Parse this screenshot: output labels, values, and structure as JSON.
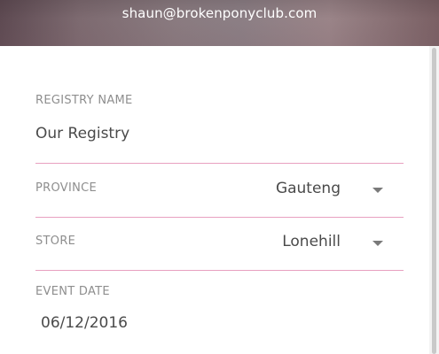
{
  "header": {
    "email": "shaun@brokenponyclub.com"
  },
  "form": {
    "registry_name": {
      "label": "REGISTRY NAME",
      "value": "Our Registry"
    },
    "province": {
      "label": "PROVINCE",
      "value": "Gauteng",
      "icon": "chevron-down-icon"
    },
    "store": {
      "label": "STORE",
      "value": "Lonehill",
      "icon": "chevron-down-icon"
    },
    "event_date": {
      "label": "EVENT DATE",
      "value": "06/12/2016"
    }
  },
  "colors": {
    "underline": "#e8a0c0",
    "label": "#8e8e8e",
    "text": "#4a4a4a"
  }
}
